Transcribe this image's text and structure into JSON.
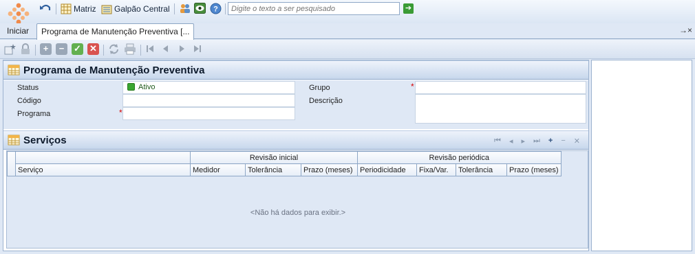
{
  "toolbar": {
    "matriz_label": "Matriz",
    "galpao_label": "Galpão Central",
    "search_placeholder": "Digite o texto a ser pesquisado"
  },
  "tabs": [
    {
      "label": "Iniciar"
    },
    {
      "label": "Programa de Manutenção Preventiva [..."
    }
  ],
  "tab_controls": "→×",
  "main": {
    "title": "Programa de Manutenção Preventiva",
    "fields": {
      "status_label": "Status",
      "status_value": "Ativo",
      "codigo_label": "Código",
      "programa_label": "Programa",
      "grupo_label": "Grupo",
      "descricao_label": "Descrição",
      "required_mark": "*"
    }
  },
  "services": {
    "title": "Serviços",
    "group_headers": [
      "Revisão inicial",
      "Revisão periódica"
    ],
    "columns": [
      "Serviço",
      "Medidor",
      "Tolerância",
      "Prazo (meses)",
      "Periodicidade",
      "Fixa/Var.",
      "Tolerância",
      "Prazo (meses)"
    ],
    "empty_text": "<Não há dados para exibir.>"
  },
  "colors": {
    "status_green": "#3aa631",
    "required_red": "#d60000",
    "accent_blue": "#9cb2cf"
  }
}
